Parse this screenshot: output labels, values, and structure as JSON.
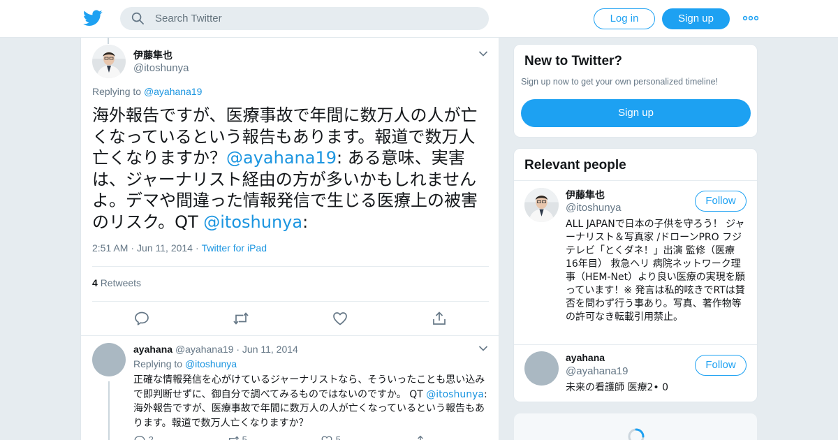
{
  "search": {
    "placeholder": "Search Twitter"
  },
  "header": {
    "login_label": "Log in",
    "signup_label": "Sign up"
  },
  "main_tweet": {
    "author_name": "伊藤隼也",
    "author_handle": "@itoshunya",
    "replying_prefix": "Replying to",
    "replying_to": "@ayahana19",
    "text_part1": "海外報告ですが、医療事故で年間に数万人の人が亡くなっているという報告もあります。報道で数万人亡くなりますか？",
    "mention1": "@ayahana19",
    "text_part2": ": ある意味、実害は、ジャーナリスト経由の方が多いかもしれませんよ。デマや間違った情報発信で生じる医療上の被害のリスク。QT ",
    "mention2": "@itoshunya",
    "text_part3": ":",
    "time": "2:51 AM",
    "date": "Jun 11, 2014",
    "source": "Twitter for iPad",
    "retweet_count": "4",
    "retweet_label": "Retweets"
  },
  "reply_tweet": {
    "author_name": "ayahana",
    "author_handle": "@ayahana19",
    "date": "Jun 11, 2014",
    "replying_prefix": "Replying to",
    "replying_to": "@itoshunya",
    "text_part1": "正確な情報発信を心がけているジャーナリストなら、そういったことも思い込みで即判断せずに、御自分で調べてみるものではないのですか。 QT ",
    "mention": "@itoshunya",
    "text_part2": ": 海外報告ですが、医療事故で年間に数万人の人が亡くなっているという報告もあります。報道で数万人亡くなりますか？",
    "reply_count": "2",
    "retweet_count": "5",
    "like_count": "5"
  },
  "sidebar": {
    "new_title": "New to Twitter?",
    "new_subtitle": "Sign up now to get your own personalized timeline!",
    "new_cta": "Sign up",
    "people_title": "Relevant people",
    "people": [
      {
        "name": "伊藤隼也",
        "handle": "@itoshunya",
        "follow_label": "Follow",
        "bio": "ALL JAPANで日本の子供を守ろう！ ジャーナリスト＆写真家 /ドローンPRO フジテレビ「とくダネ！」出演 監修（医療 16年目） 救急ヘリ 病院ネットワーク理事（HEM-Net）より良い医療の実現を願っています！※ 発言は私的呟きでRTは賛否を問わず行う事あり。写真、著作物等の許可なき転載引用禁止。"
      },
      {
        "name": "ayahana",
        "handle": "@ayahana19",
        "follow_label": "Follow",
        "bio": "未来の看護師 医療2• 0"
      }
    ]
  },
  "colors": {
    "brand": "#1da1f2",
    "link": "#1b95e0",
    "muted": "#657786",
    "background": "#e6ecf0"
  },
  "icons": [
    "twitter-bird-icon",
    "search-icon",
    "more-dots-icon",
    "chevron-down-icon",
    "reply-icon",
    "retweet-icon",
    "like-icon",
    "share-icon",
    "loading-spinner-icon"
  ]
}
